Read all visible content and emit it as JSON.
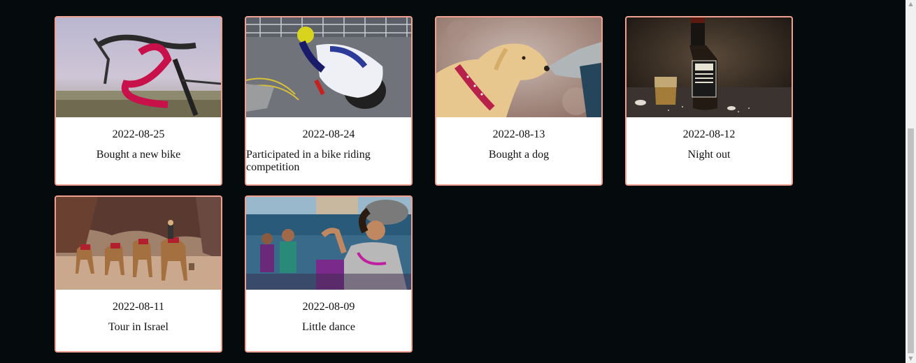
{
  "cards": [
    {
      "date": "2022-08-25",
      "title": "Bought a new bike",
      "image": "bike-handlebar-photo"
    },
    {
      "date": "2022-08-24",
      "title": "Participated in a bike riding competition",
      "image": "motorcycle-racer-photo"
    },
    {
      "date": "2022-08-13",
      "title": "Bought a dog",
      "image": "dog-photo"
    },
    {
      "date": "2022-08-12",
      "title": "Night out",
      "image": "whiskey-bottle-photo"
    },
    {
      "date": "2022-08-11",
      "title": "Tour in Israel",
      "image": "camels-desert-photo"
    },
    {
      "date": "2022-08-09",
      "title": "Little dance",
      "image": "folk-dancer-photo"
    }
  ],
  "colors": {
    "background": "#050a0d",
    "card_border": "#f0a090",
    "card_background": "#ffffff"
  }
}
